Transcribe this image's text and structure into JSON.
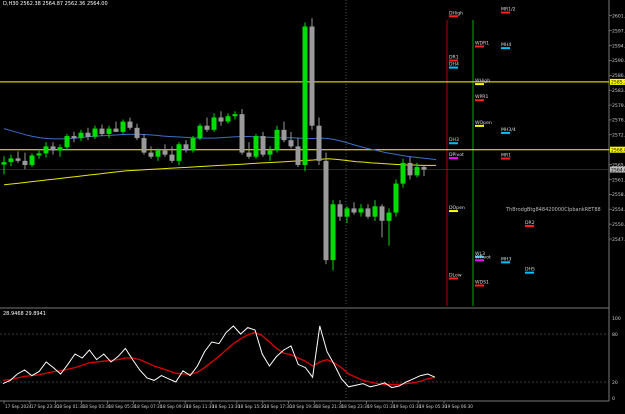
{
  "window": {
    "title": "D,H30  2562.38  2564.87  2562.36  2564.00",
    "oscillator_title": "28.9468  29.8941"
  },
  "colors": {
    "background": "#000000",
    "bull": "#00dd00",
    "bear": "#9a9a9a",
    "level_yellow": "#ffff00",
    "ma_blue": "#3d6fc9",
    "ma_yellow": "#e8e800",
    "osc_white": "#ffffff",
    "osc_red": "#dd0000",
    "vline_green": "#00aa00",
    "vline_dotted": "#888888"
  },
  "price_axis": {
    "ticks": [
      "2601.20",
      "2597.60",
      "2594.00",
      "2590.40",
      "2586.80",
      "2583.20",
      "2579.60",
      "2576.00",
      "2572.40",
      "2568.80",
      "2565.20",
      "2561.60",
      "2558.00",
      "2554.40",
      "2550.80",
      "2547.20"
    ],
    "highlight_labels": [
      {
        "text": "2585.20",
        "value": 2585.2
      },
      {
        "text": "2568.80",
        "value": 2568.8
      },
      {
        "text": "2564.00",
        "value": 2564.0
      }
    ]
  },
  "osc_axis": {
    "ticks": [
      "100",
      "80",
      "20",
      "0"
    ]
  },
  "time_axis": {
    "labels": [
      "17 Sep 2024",
      "17 Sep 23:30",
      "18 Sep 01:30",
      "18 Sep 03:30",
      "18 Sep 05:30",
      "18 Sep 07:30",
      "18 Sep 09:30",
      "18 Sep 11:30",
      "18 Sep 13:30",
      "18 Sep 15:30",
      "18 Sep 17:30",
      "18 Sep 19:30",
      "18 Sep 21:30",
      "18 Sep 23:30",
      "19 Sep 01:30",
      "19 Sep 03:30",
      "19 Sep 05:30",
      "19 Sep 06:30"
    ]
  },
  "levels": [
    {
      "label": "DHigh",
      "value": 2601.3,
      "color": "#ff2020",
      "col": "a"
    },
    {
      "label": "MR1/2",
      "value": 2602.2,
      "color": "#ff2020",
      "col": "c"
    },
    {
      "label": "WDR1",
      "value": 2594.0,
      "color": "#ff2020",
      "col": "b"
    },
    {
      "label": "MH4",
      "value": 2593.6,
      "color": "#00c0ff",
      "col": "c"
    },
    {
      "label": "DR1",
      "value": 2590.6,
      "color": "#ff2020",
      "col": "a"
    },
    {
      "label": "DH4",
      "value": 2588.9,
      "color": "#00c0ff",
      "col": "a"
    },
    {
      "label": "WHigh",
      "value": 2584.9,
      "color": "#ffff00",
      "col": "b"
    },
    {
      "label": "WPR1",
      "value": 2581.0,
      "color": "#ff2020",
      "col": "b"
    },
    {
      "label": "WOpen",
      "value": 2574.8,
      "color": "#ffff00",
      "col": "b"
    },
    {
      "label": "MH3/4",
      "value": 2573.1,
      "color": "#00c0ff",
      "col": "c"
    },
    {
      "label": "DH3",
      "value": 2570.6,
      "color": "#00c0ff",
      "col": "a"
    },
    {
      "label": "DPivot",
      "value": 2567.0,
      "color": "#ff00ff",
      "col": "a"
    },
    {
      "label": "MR1",
      "value": 2566.9,
      "color": "#ff2020",
      "col": "c"
    },
    {
      "label": "DOpen",
      "value": 2554.2,
      "color": "#ffff00",
      "col": "a"
    },
    {
      "label": "DR2",
      "value": 2550.6,
      "color": "#ff2020",
      "col": "d"
    },
    {
      "label": "WL3",
      "value": 2543.1,
      "color": "#00c0ff",
      "col": "b"
    },
    {
      "label": "WPivot",
      "value": 2542.3,
      "color": "#ff00ff",
      "col": "b"
    },
    {
      "label": "MH3",
      "value": 2541.8,
      "color": "#00c0ff",
      "col": "c"
    },
    {
      "label": "DH5",
      "value": 2539.3,
      "color": "#00c0ff",
      "col": "d"
    },
    {
      "label": "DLow",
      "value": 2537.9,
      "color": "#ff2020",
      "col": "a"
    },
    {
      "label": "WDS1",
      "value": 2536.2,
      "color": "#ff2020",
      "col": "b"
    }
  ],
  "horizontal_lines": [
    2585.2,
    2568.8
  ],
  "grid_label": "ThBrodgBtg848420000CIpbankRET88",
  "chart_data": {
    "type": "candlestick",
    "title": "D,H30",
    "ylim": [
      2531.0,
      2605.0
    ],
    "candles": [
      {
        "o": 2565.2,
        "h": 2567.2,
        "l": 2562.8,
        "c": 2565.8
      },
      {
        "o": 2565.8,
        "h": 2567.6,
        "l": 2564.8,
        "c": 2566.7
      },
      {
        "o": 2566.7,
        "h": 2568.4,
        "l": 2565.6,
        "c": 2566.1
      },
      {
        "o": 2566.1,
        "h": 2568.1,
        "l": 2564.1,
        "c": 2565.1
      },
      {
        "o": 2565.1,
        "h": 2567.9,
        "l": 2564.6,
        "c": 2567.4
      },
      {
        "o": 2567.4,
        "h": 2568.9,
        "l": 2566.6,
        "c": 2567.9
      },
      {
        "o": 2567.9,
        "h": 2570.6,
        "l": 2566.9,
        "c": 2569.6
      },
      {
        "o": 2569.6,
        "h": 2570.6,
        "l": 2567.6,
        "c": 2568.6
      },
      {
        "o": 2568.6,
        "h": 2570.1,
        "l": 2567.1,
        "c": 2569.4
      },
      {
        "o": 2569.4,
        "h": 2572.6,
        "l": 2568.6,
        "c": 2572.1
      },
      {
        "o": 2572.1,
        "h": 2573.1,
        "l": 2570.6,
        "c": 2571.6
      },
      {
        "o": 2571.6,
        "h": 2573.6,
        "l": 2570.9,
        "c": 2572.9
      },
      {
        "o": 2572.9,
        "h": 2574.1,
        "l": 2571.1,
        "c": 2571.9
      },
      {
        "o": 2571.9,
        "h": 2574.6,
        "l": 2571.4,
        "c": 2573.9
      },
      {
        "o": 2573.9,
        "h": 2574.9,
        "l": 2572.1,
        "c": 2572.6
      },
      {
        "o": 2572.6,
        "h": 2574.6,
        "l": 2571.6,
        "c": 2573.9
      },
      {
        "o": 2573.9,
        "h": 2575.6,
        "l": 2573.1,
        "c": 2573.1
      },
      {
        "o": 2573.1,
        "h": 2576.1,
        "l": 2572.6,
        "c": 2575.6
      },
      {
        "o": 2575.6,
        "h": 2576.6,
        "l": 2573.6,
        "c": 2574.1
      },
      {
        "o": 2574.1,
        "h": 2575.1,
        "l": 2571.1,
        "c": 2571.6
      },
      {
        "o": 2571.6,
        "h": 2572.6,
        "l": 2567.6,
        "c": 2568.1
      },
      {
        "o": 2568.1,
        "h": 2569.6,
        "l": 2566.6,
        "c": 2567.1
      },
      {
        "o": 2567.1,
        "h": 2569.1,
        "l": 2566.1,
        "c": 2568.6
      },
      {
        "o": 2568.6,
        "h": 2570.1,
        "l": 2567.1,
        "c": 2567.6
      },
      {
        "o": 2567.6,
        "h": 2569.6,
        "l": 2565.6,
        "c": 2566.1
      },
      {
        "o": 2566.1,
        "h": 2570.6,
        "l": 2565.1,
        "c": 2570.1
      },
      {
        "o": 2570.1,
        "h": 2571.1,
        "l": 2568.1,
        "c": 2568.6
      },
      {
        "o": 2568.6,
        "h": 2572.1,
        "l": 2568.1,
        "c": 2571.6
      },
      {
        "o": 2571.6,
        "h": 2575.1,
        "l": 2571.1,
        "c": 2574.6
      },
      {
        "o": 2574.6,
        "h": 2576.6,
        "l": 2573.1,
        "c": 2573.6
      },
      {
        "o": 2573.6,
        "h": 2577.6,
        "l": 2573.1,
        "c": 2576.6
      },
      {
        "o": 2576.6,
        "h": 2578.1,
        "l": 2574.6,
        "c": 2575.6
      },
      {
        "o": 2575.6,
        "h": 2577.6,
        "l": 2575.1,
        "c": 2576.9
      },
      {
        "o": 2576.9,
        "h": 2578.1,
        "l": 2576.1,
        "c": 2577.4
      },
      {
        "o": 2577.4,
        "h": 2578.6,
        "l": 2567.6,
        "c": 2568.1
      },
      {
        "o": 2568.1,
        "h": 2570.6,
        "l": 2566.6,
        "c": 2567.1
      },
      {
        "o": 2567.1,
        "h": 2572.6,
        "l": 2566.6,
        "c": 2572.1
      },
      {
        "o": 2572.1,
        "h": 2573.1,
        "l": 2567.1,
        "c": 2567.6
      },
      {
        "o": 2567.6,
        "h": 2569.6,
        "l": 2566.1,
        "c": 2568.6
      },
      {
        "o": 2568.6,
        "h": 2574.6,
        "l": 2568.1,
        "c": 2573.6
      },
      {
        "o": 2573.6,
        "h": 2575.6,
        "l": 2570.6,
        "c": 2571.1
      },
      {
        "o": 2571.1,
        "h": 2573.1,
        "l": 2569.1,
        "c": 2569.6
      },
      {
        "o": 2569.6,
        "h": 2571.6,
        "l": 2564.6,
        "c": 2565.1
      },
      {
        "o": 2565.1,
        "h": 2599.6,
        "l": 2563.6,
        "c": 2598.6
      },
      {
        "o": 2598.6,
        "h": 2600.6,
        "l": 2573.6,
        "c": 2574.6
      },
      {
        "o": 2574.6,
        "h": 2576.6,
        "l": 2565.1,
        "c": 2566.1
      },
      {
        "o": 2566.1,
        "h": 2568.1,
        "l": 2541.1,
        "c": 2542.1
      },
      {
        "o": 2542.1,
        "h": 2556.6,
        "l": 2539.6,
        "c": 2555.6
      },
      {
        "o": 2555.6,
        "h": 2556.6,
        "l": 2551.6,
        "c": 2552.6
      },
      {
        "o": 2552.6,
        "h": 2555.1,
        "l": 2551.1,
        "c": 2554.6
      },
      {
        "o": 2554.6,
        "h": 2556.1,
        "l": 2553.1,
        "c": 2553.6
      },
      {
        "o": 2553.6,
        "h": 2555.6,
        "l": 2552.6,
        "c": 2554.6
      },
      {
        "o": 2554.6,
        "h": 2555.6,
        "l": 2552.1,
        "c": 2552.6
      },
      {
        "o": 2552.6,
        "h": 2556.6,
        "l": 2551.6,
        "c": 2555.1
      },
      {
        "o": 2555.1,
        "h": 2555.6,
        "l": 2547.6,
        "c": 2551.6
      },
      {
        "o": 2551.6,
        "h": 2554.6,
        "l": 2545.6,
        "c": 2553.6
      },
      {
        "o": 2553.6,
        "h": 2561.6,
        "l": 2552.6,
        "c": 2560.6
      },
      {
        "o": 2560.6,
        "h": 2566.6,
        "l": 2559.6,
        "c": 2565.6
      },
      {
        "o": 2565.6,
        "h": 2567.1,
        "l": 2561.6,
        "c": 2562.6
      },
      {
        "o": 2562.6,
        "h": 2565.6,
        "l": 2562.1,
        "c": 2564.6
      },
      {
        "o": 2564.6,
        "h": 2564.9,
        "l": 2562.4,
        "c": 2564.0
      }
    ],
    "ma_blue": [
      2573.9,
      2573.4,
      2572.9,
      2572.4,
      2572.0,
      2571.7,
      2571.5,
      2571.4,
      2571.4,
      2571.5,
      2571.6,
      2571.8,
      2572.0,
      2572.1,
      2572.2,
      2572.3,
      2572.4,
      2572.5,
      2572.5,
      2572.5,
      2572.4,
      2572.3,
      2572.1,
      2572.0,
      2571.9,
      2571.8,
      2571.7,
      2571.6,
      2571.6,
      2571.6,
      2571.7,
      2571.8,
      2571.9,
      2572.0,
      2572.0,
      2571.9,
      2571.8,
      2571.8,
      2571.7,
      2571.7,
      2571.7,
      2571.6,
      2571.5,
      2571.5,
      2571.6,
      2571.5,
      2571.2,
      2570.8,
      2570.3,
      2569.8,
      2569.3,
      2568.9,
      2568.5,
      2568.1,
      2567.8,
      2567.5,
      2567.2,
      2567.0,
      2566.8,
      2566.6,
      2566.4
    ],
    "ma_yellow": [
      2560.3,
      2560.5,
      2560.7,
      2560.9,
      2561.1,
      2561.3,
      2561.5,
      2561.7,
      2561.9,
      2562.1,
      2562.3,
      2562.5,
      2562.7,
      2562.9,
      2563.1,
      2563.3,
      2563.5,
      2563.7,
      2563.8,
      2563.9,
      2564.0,
      2564.1,
      2564.2,
      2564.3,
      2564.4,
      2564.5,
      2564.6,
      2564.7,
      2564.8,
      2564.9,
      2565.0,
      2565.1,
      2565.2,
      2565.3,
      2565.4,
      2565.5,
      2565.6,
      2565.7,
      2565.8,
      2565.9,
      2566.0,
      2566.1,
      2566.2,
      2566.3,
      2566.5,
      2566.6,
      2566.5,
      2566.3,
      2566.1,
      2565.9,
      2565.8,
      2565.6,
      2565.5,
      2565.4,
      2565.3,
      2565.2,
      2565.1,
      2565.1,
      2565.0,
      2565.0,
      2565.0
    ],
    "osc_ylim": [
      0,
      110
    ],
    "osc_white": [
      18,
      22,
      30,
      35,
      28,
      33,
      45,
      38,
      30,
      42,
      55,
      50,
      60,
      48,
      55,
      45,
      52,
      62,
      48,
      35,
      25,
      22,
      28,
      24,
      20,
      34,
      28,
      40,
      58,
      70,
      68,
      82,
      90,
      80,
      88,
      85,
      55,
      40,
      52,
      60,
      65,
      42,
      38,
      26,
      90,
      58,
      42,
      24,
      14,
      16,
      18,
      14,
      16,
      19,
      13,
      15,
      20,
      24,
      28,
      30,
      26
    ],
    "osc_red": [
      22,
      23,
      25,
      27,
      28,
      29,
      31,
      33,
      34,
      36,
      38,
      41,
      44,
      45,
      46,
      47,
      48,
      50,
      50,
      48,
      44,
      40,
      37,
      34,
      31,
      30,
      30,
      32,
      38,
      45,
      52,
      60,
      68,
      74,
      79,
      82,
      78,
      70,
      62,
      56,
      54,
      50,
      46,
      40,
      45,
      48,
      44,
      38,
      30,
      26,
      22,
      20,
      18,
      17,
      17,
      17,
      18,
      19,
      21,
      24,
      26
    ]
  }
}
